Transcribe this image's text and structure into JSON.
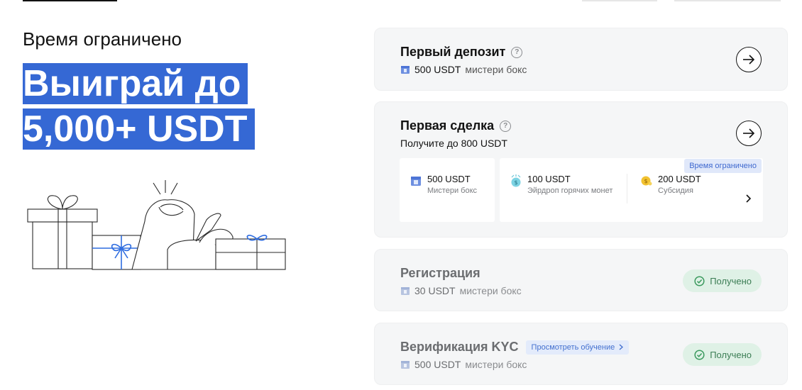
{
  "hero": {
    "eyebrow": "Время ограничено",
    "headline": "Выиграй до 5,000+ USDT"
  },
  "tasks": [
    {
      "title": "Первый депозит",
      "reward_amount": "500 USDT",
      "reward_label": "мистери бокс"
    },
    {
      "title": "Первая сделка",
      "subtitle": "Получите до 800 USDT",
      "badge": "Время ограничено",
      "rewards": [
        {
          "value": "500 USDT",
          "label": "Мистери бокс",
          "icon": "mystery-box-icon"
        },
        {
          "value": "100 USDT",
          "label": "Эйрдроп горячих монет",
          "icon": "airdrop-coin-icon"
        },
        {
          "value": "200 USDT",
          "label": "Субсидия",
          "icon": "subsidy-coin-icon"
        }
      ]
    },
    {
      "title": "Регистрация",
      "reward_amount": "30 USDT",
      "reward_label": "мистери бокс",
      "status": "Получено"
    },
    {
      "title": "Верификация KYC",
      "tutorial_link": "Просмотреть обучение",
      "reward_amount": "500 USDT",
      "reward_label": "мистери бокс",
      "status": "Получено"
    }
  ],
  "colors": {
    "accent": "#3568d4",
    "received_bg": "#dff1e6",
    "received_text": "#3b7d54",
    "card_bg": "#f5f6f7"
  }
}
